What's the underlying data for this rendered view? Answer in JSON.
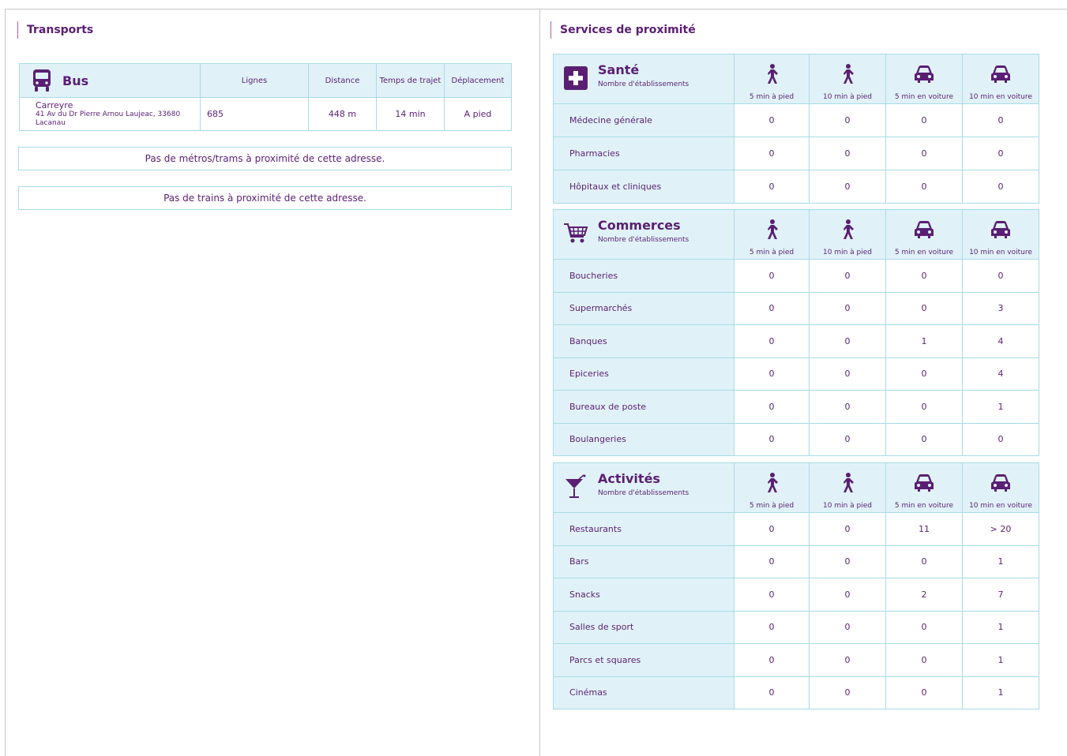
{
  "transports": {
    "title": "Transports",
    "bus": {
      "label": "Bus",
      "icon": "bus-icon",
      "headers": [
        "Lignes",
        "Distance",
        "Temps de trajet",
        "Déplacement"
      ],
      "stop": {
        "name": "Carreyre",
        "address_line1": "41 Av du Dr Pierre Arnou Laujeac, 33680",
        "address_line2": "Lacanau",
        "line": "685",
        "distance": "448 m",
        "travel_time": "14 min",
        "mode": "A pied"
      }
    },
    "metro_notice": "Pas de métros/trams à proximité de cette adresse.",
    "train_notice": "Pas de trains à proximité de cette adresse."
  },
  "services": {
    "title": "Services de proximité",
    "columns": [
      "5 min à pied",
      "10 min à pied",
      "5 min en voiture",
      "10 min en voiture"
    ],
    "column_icons": [
      "walk-icon",
      "walk-icon",
      "car-icon",
      "car-icon"
    ],
    "subtitle": "Nombre d'établissements",
    "sante": {
      "title": "Santé",
      "icon": "health-cross-icon",
      "rows": [
        {
          "label": "Médecine générale",
          "values": [
            "0",
            "0",
            "0",
            "0"
          ]
        },
        {
          "label": "Pharmacies",
          "values": [
            "0",
            "0",
            "0",
            "0"
          ]
        },
        {
          "label": "Hôpitaux et cliniques",
          "values": [
            "0",
            "0",
            "0",
            "0"
          ]
        }
      ]
    },
    "commerces": {
      "title": "Commerces",
      "icon": "shopping-cart-icon",
      "rows": [
        {
          "label": "Boucheries",
          "values": [
            "0",
            "0",
            "0",
            "0"
          ]
        },
        {
          "label": "Supermarchés",
          "values": [
            "0",
            "0",
            "0",
            "3"
          ]
        },
        {
          "label": "Banques",
          "values": [
            "0",
            "0",
            "1",
            "4"
          ]
        },
        {
          "label": "Epiceries",
          "values": [
            "0",
            "0",
            "0",
            "4"
          ]
        },
        {
          "label": "Bureaux de poste",
          "values": [
            "0",
            "0",
            "0",
            "1"
          ]
        },
        {
          "label": "Boulangeries",
          "values": [
            "0",
            "0",
            "0",
            "0"
          ]
        }
      ]
    },
    "activites": {
      "title": "Activités",
      "icon": "cocktail-glass-icon",
      "rows": [
        {
          "label": "Restaurants",
          "values": [
            "0",
            "0",
            "11",
            "> 20"
          ]
        },
        {
          "label": "Bars",
          "values": [
            "0",
            "0",
            "0",
            "1"
          ]
        },
        {
          "label": "Snacks",
          "values": [
            "0",
            "0",
            "2",
            "7"
          ]
        },
        {
          "label": "Salles de sport",
          "values": [
            "0",
            "0",
            "0",
            "1"
          ]
        },
        {
          "label": "Parcs et squares",
          "values": [
            "0",
            "0",
            "0",
            "1"
          ]
        },
        {
          "label": "Cinémas",
          "values": [
            "0",
            "0",
            "0",
            "1"
          ]
        }
      ]
    }
  },
  "colors": {
    "primary": "#5a1f73",
    "header_bg": "#e0f2f8",
    "border": "#a8dbe6"
  }
}
